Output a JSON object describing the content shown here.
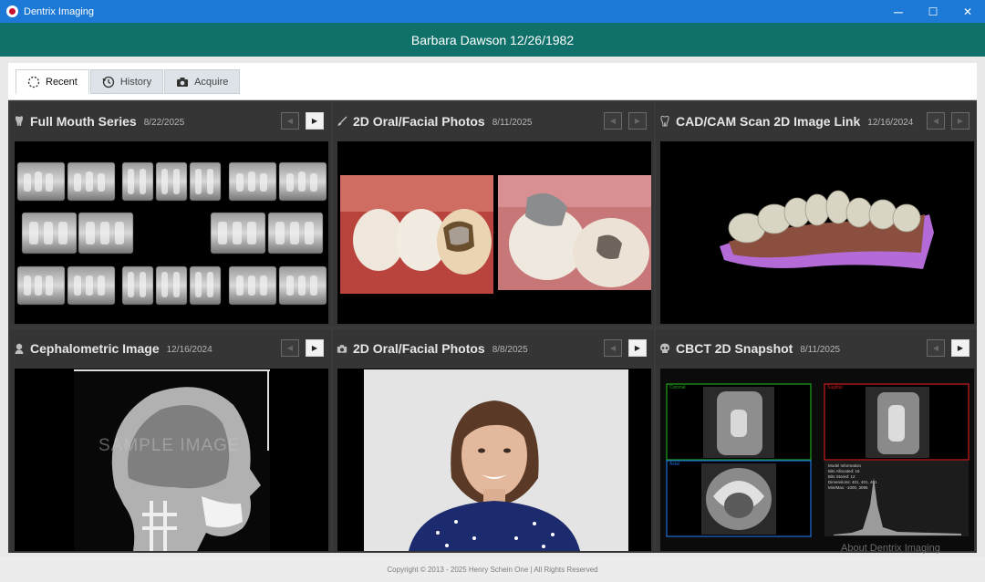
{
  "window": {
    "title": "Dentrix Imaging",
    "controls": {
      "minimize": "─",
      "maximize": "☐",
      "close": "✕"
    }
  },
  "patient": {
    "name_dob": "Barbara Dawson 12/26/1982"
  },
  "tabs": [
    {
      "label": "Recent",
      "icon": "recent-icon",
      "active": true
    },
    {
      "label": "History",
      "icon": "history-icon",
      "active": false
    },
    {
      "label": "Acquire",
      "icon": "camera-icon",
      "active": false
    }
  ],
  "panels": [
    {
      "title": "Full Mouth Series",
      "date": "8/22/2025",
      "icon": "tooth-icon",
      "prev_enabled": false,
      "next_enabled": true
    },
    {
      "title": "2D Oral/Facial Photos",
      "date": "8/11/2025",
      "icon": "brush-icon",
      "prev_enabled": false,
      "next_enabled": false
    },
    {
      "title": "CAD/CAM Scan 2D Image Link",
      "date": "12/16/2024",
      "icon": "tooth-icon",
      "prev_enabled": false,
      "next_enabled": false
    },
    {
      "title": "Cephalometric Image",
      "date": "12/16/2024",
      "icon": "person-icon",
      "prev_enabled": false,
      "next_enabled": true
    },
    {
      "title": "2D Oral/Facial Photos",
      "date": "8/8/2025",
      "icon": "camera-icon",
      "prev_enabled": false,
      "next_enabled": true
    },
    {
      "title": "CBCT 2D Snapshot",
      "date": "8/11/2025",
      "icon": "skull-icon",
      "prev_enabled": false,
      "next_enabled": true
    }
  ],
  "ceph_watermark": "SAMPLE IMAGE",
  "cbct": {
    "views": [
      "Coronal",
      "Sagittal",
      "Axial"
    ],
    "model_info": [
      "Model Information",
      "Bits Allocated: 16",
      "Bits Stored: 12",
      "Dimensions: 401, 401, 401",
      "Min/Max: -1000, 3095"
    ]
  },
  "about_link": "About Dentrix Imaging",
  "footer": "Copyright © 2013 - 2025 Henry Schein One | All Rights Reserved",
  "colors": {
    "titlebar": "#1d79d6",
    "patient_header": "#0f7169",
    "panel": "#353535",
    "cbct_coronal": "#1fa31f",
    "cbct_sagittal": "#c81d1d",
    "cbct_axial": "#1e6ed8",
    "scan_gum": "#b46bd8"
  }
}
